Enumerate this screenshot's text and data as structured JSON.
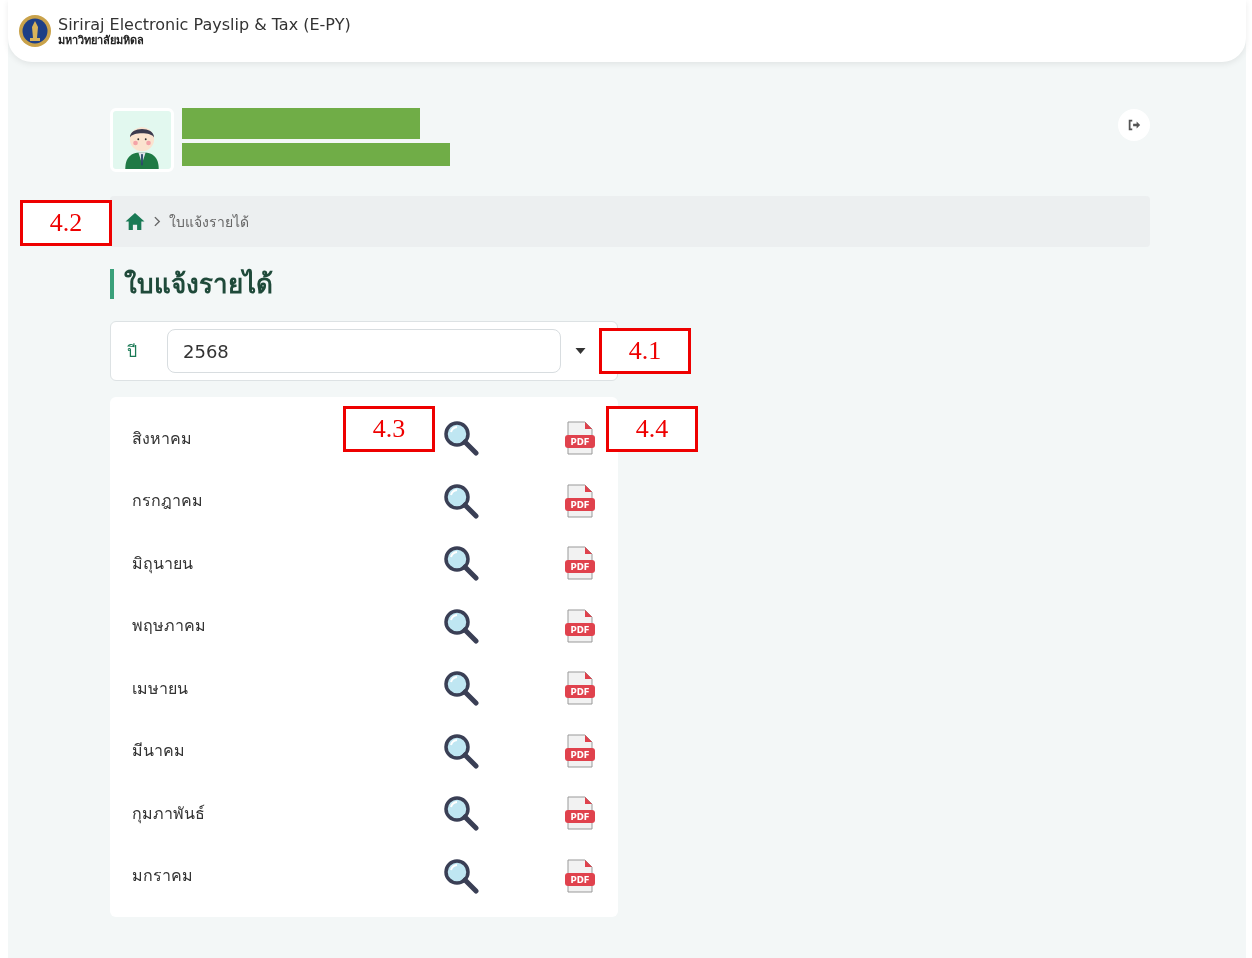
{
  "header": {
    "title": "Siriraj Electronic Payslip & Tax (E-PY)",
    "subtitle": "มหาวิทยาลัยมหิดล"
  },
  "breadcrumb": {
    "current": "ใบแจ้งรายได้"
  },
  "page_title": "ใบแจ้งรายได้",
  "year_select": {
    "label": "ปี",
    "value": "2568"
  },
  "months": [
    {
      "name": "สิงหาคม",
      "pdf_label": "PDF"
    },
    {
      "name": "กรกฎาคม",
      "pdf_label": "PDF"
    },
    {
      "name": "มิถุนายน",
      "pdf_label": "PDF"
    },
    {
      "name": "พฤษภาคม",
      "pdf_label": "PDF"
    },
    {
      "name": "เมษายน",
      "pdf_label": "PDF"
    },
    {
      "name": "มีนาคม",
      "pdf_label": "PDF"
    },
    {
      "name": "กุมภาพันธ์",
      "pdf_label": "PDF"
    },
    {
      "name": "มกราคม",
      "pdf_label": "PDF"
    }
  ],
  "annotations": [
    {
      "label": "4.2",
      "kind": "breadcrumb"
    },
    {
      "label": "4.1",
      "kind": "select"
    },
    {
      "label": "4.3",
      "kind": "view"
    },
    {
      "label": "4.4",
      "kind": "download"
    }
  ]
}
